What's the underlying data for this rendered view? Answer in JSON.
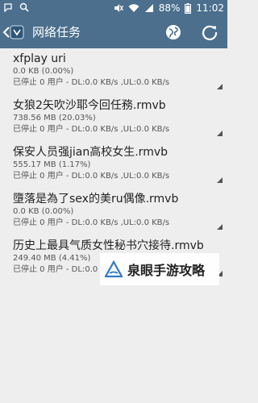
{
  "status_bar": {
    "battery": "88%",
    "time": "11:02",
    "icons": [
      "notification-icon",
      "search-icon",
      "mute-icon",
      "wifi-icon",
      "signal-icon",
      "battery-icon"
    ]
  },
  "app_bar": {
    "title": "网络任务",
    "icons": [
      "back-icon",
      "app-logo-icon",
      "globe-icon",
      "refresh-icon"
    ],
    "accent_color": "#4b6f8d"
  },
  "tasks": [
    {
      "name": "xfplay uri",
      "size": "0.0 KB  (0.00%)",
      "status": "已停止  0 用户 - DL:0.0 KB/s ,UL:0.0 KB/s"
    },
    {
      "name": "女狼2矢吹沙耶今回任務.rmvb",
      "size": "738.56 MB  (20.03%)",
      "status": "已停止  0 用户 - DL:0.0 KB/s ,UL:0.0 KB/s"
    },
    {
      "name": "保安人员强jian高校女生.rmvb",
      "size": "555.17 MB  (1.17%)",
      "status": "已停止  0 用户 - DL:0.0 KB/s ,UL:0.0 KB/s"
    },
    {
      "name": "墮落是為了sex的美ru偶像.rmvb",
      "size": "0.0 KB  (0.00%)",
      "status": "已停止  0 用户 - DL:0.0 KB/s ,UL:0.0 KB/s"
    },
    {
      "name": "历史上最具气质女性秘书穴接待.rmvb",
      "size": "249.40 MB  (4.41%)",
      "status": "已停止  0 用户 - DL:0.0 KB/s ,UL:0.0 KB/s"
    }
  ],
  "watermark": {
    "text": "泉眼手游攻略"
  }
}
